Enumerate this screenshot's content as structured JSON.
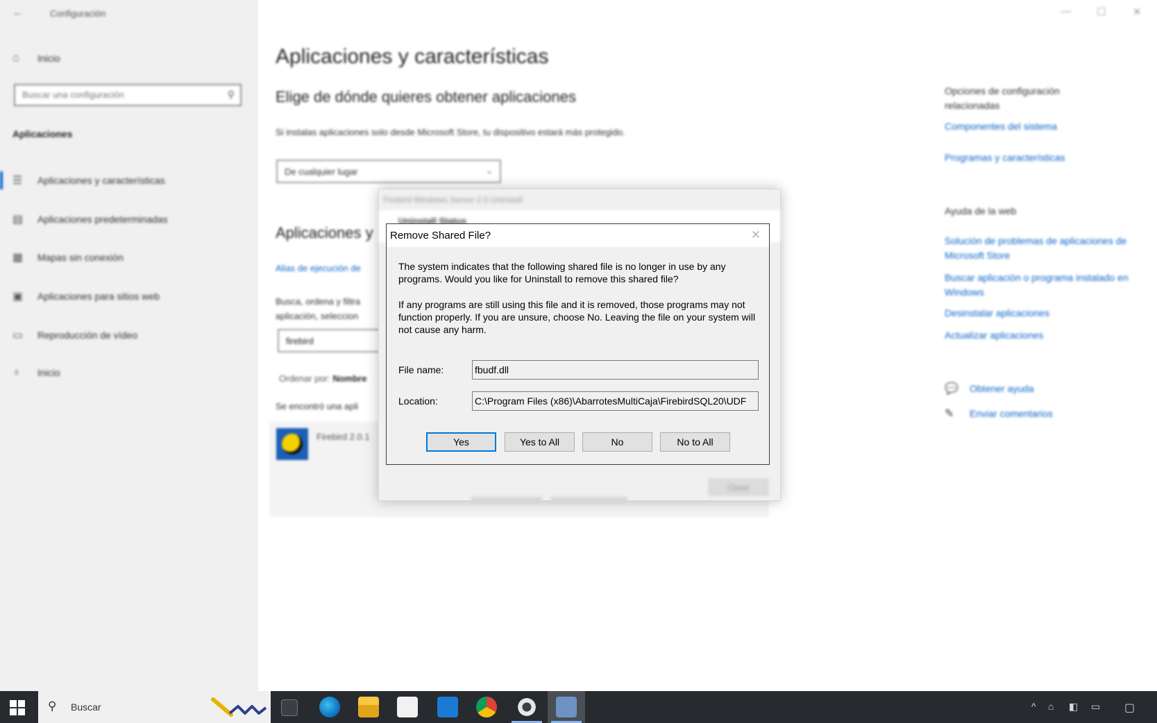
{
  "settings": {
    "window_title": "Configuración",
    "back_glyph": "←",
    "controls": {
      "minimize": "—",
      "maximize": "☐",
      "close": "✕"
    },
    "sidebar": {
      "home_label": "Inicio",
      "search_placeholder": "Buscar una configuración",
      "section_label": "Aplicaciones",
      "items": [
        {
          "label": "Aplicaciones y características",
          "icon": "apps-list-icon"
        },
        {
          "label": "Aplicaciones predeterminadas",
          "icon": "default-apps-icon"
        },
        {
          "label": "Mapas sin conexión",
          "icon": "offline-maps-icon"
        },
        {
          "label": "Aplicaciones para sitios web",
          "icon": "websites-icon"
        },
        {
          "label": "Reproducción de vídeo",
          "icon": "video-icon"
        },
        {
          "label": "Inicio",
          "icon": "startup-icon"
        }
      ]
    },
    "main": {
      "title": "Aplicaciones y características",
      "choose_heading": "Elige de dónde quieres obtener aplicaciones",
      "choose_desc": "Si instalas aplicaciones solo desde Microsoft Store, tu dispositivo estará más protegido.",
      "source_select_value": "De cualquier lugar",
      "apps_heading": "Aplicaciones y",
      "alias_link": "Alias de ejecución de",
      "search_desc": "Busca, ordena y filtra aplicación, seleccion",
      "search_value": "firebird",
      "sort_label": "Ordenar por:",
      "sort_value": "Nombre",
      "found_text": "Se encontró una apli",
      "app_name": "Firebird 2.0.1"
    },
    "related": {
      "title": "Opciones de configuración relacionadas",
      "links": [
        "Componentes del sistema",
        "Programas y características"
      ],
      "help_title": "Ayuda de la web",
      "help_links": [
        "Solución de problemas de aplicaciones de Microsoft Store",
        "Buscar aplicación o programa instalado en Windows",
        "Desinstalar aplicaciones",
        "Actualizar aplicaciones"
      ],
      "get_help": "Obtener ayuda",
      "feedback": "Enviar comentarios"
    }
  },
  "uninstall_window": {
    "title": "Firebird Windows Server 2.0 Uninstall",
    "header": "Uninstall Status",
    "close_label": "Close"
  },
  "dialog": {
    "title": "Remove Shared File?",
    "close_glyph": "✕",
    "message1": "The system indicates that the following shared file is no longer in use by any programs. Would you like for Uninstall to remove this shared file?",
    "message2": "If any programs are still using this file and it is removed, those programs may not function properly. If you are unsure, choose No. Leaving the file on your system will not cause any harm.",
    "file_name_label": "File name:",
    "file_name_value": "fbudf.dll",
    "location_label": "Location:",
    "location_value": "C:\\Program Files (x86)\\AbarrotesMultiCaja\\FirebirdSQL20\\UDF",
    "buttons": {
      "yes": "Yes",
      "yes_to_all": "Yes to All",
      "no": "No",
      "no_to_all": "No to All"
    }
  },
  "taskbar": {
    "search_text": "Buscar",
    "tray": [
      "^",
      "⌂",
      "◧",
      "▭"
    ]
  }
}
